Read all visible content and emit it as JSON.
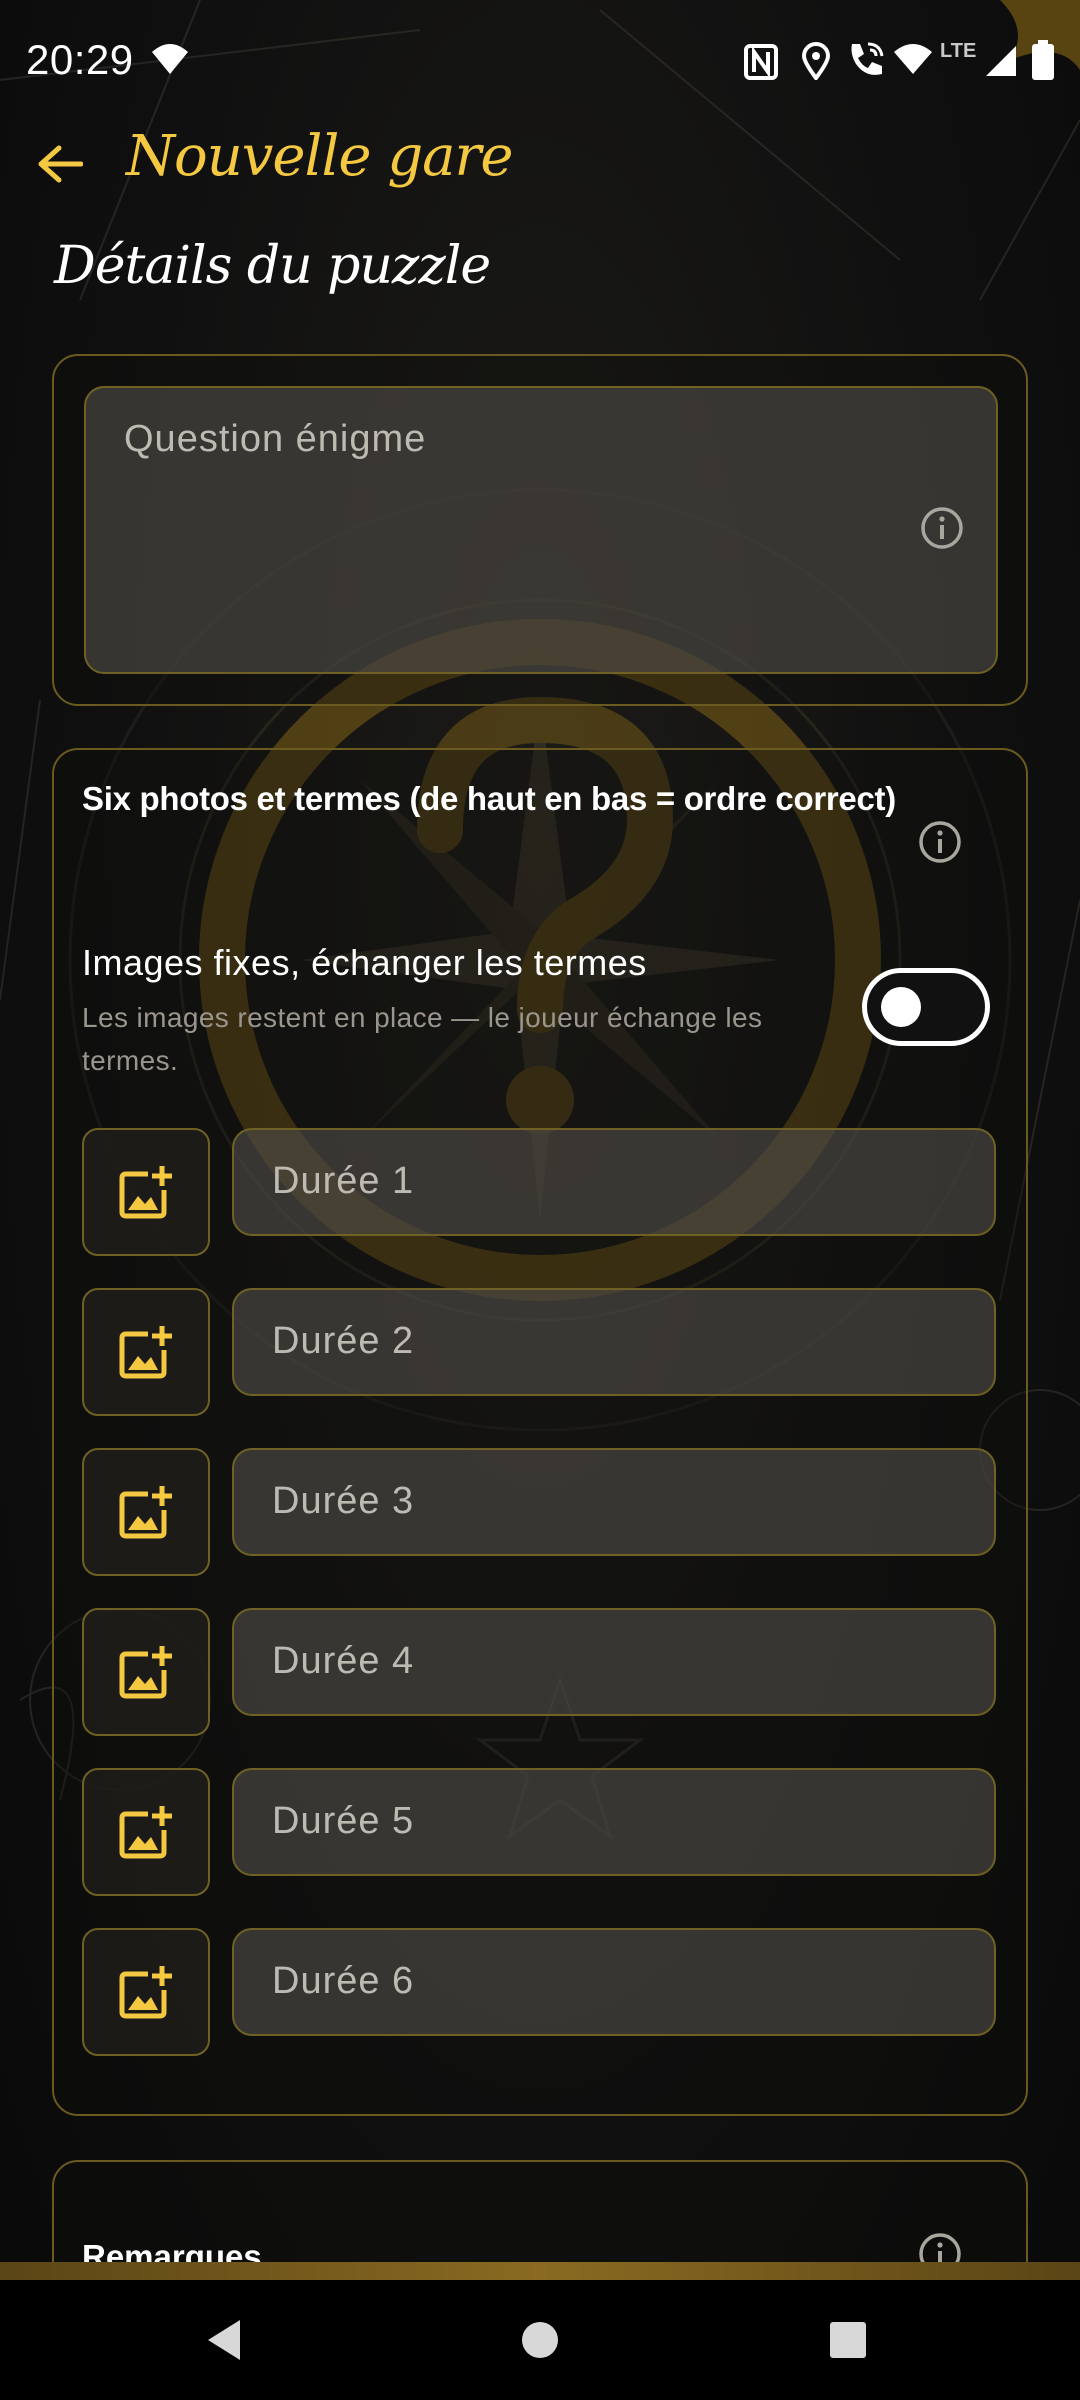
{
  "status_bar": {
    "time": "20:29",
    "network_label": "LTE",
    "icons": [
      "wifi-icon",
      "nfc-icon",
      "location-icon",
      "wifi-calling-icon",
      "wifi-icon",
      "cell-signal-icon",
      "battery-icon"
    ]
  },
  "app_bar": {
    "title": "Nouvelle gare",
    "back_icon": "arrow-left-icon"
  },
  "section_title": "Détails du puzzle",
  "question": {
    "placeholder": "Question énigme",
    "value": ""
  },
  "photos": {
    "heading": "Six photos et termes (de haut en bas = ordre correct)",
    "toggle": {
      "label": "Images fixes, échanger les termes",
      "description": "Les images restent en place — le joueur échange les termes.",
      "on": false
    },
    "rows": [
      {
        "placeholder": "Durée 1",
        "value": ""
      },
      {
        "placeholder": "Durée 2",
        "value": ""
      },
      {
        "placeholder": "Durée 3",
        "value": ""
      },
      {
        "placeholder": "Durée 4",
        "value": ""
      },
      {
        "placeholder": "Durée 5",
        "value": ""
      },
      {
        "placeholder": "Durée 6",
        "value": ""
      }
    ]
  },
  "remarks": {
    "heading": "Remarques"
  },
  "colors": {
    "accent": "#f5c842",
    "border": "#6f6123",
    "field_bg": "#504e48"
  }
}
